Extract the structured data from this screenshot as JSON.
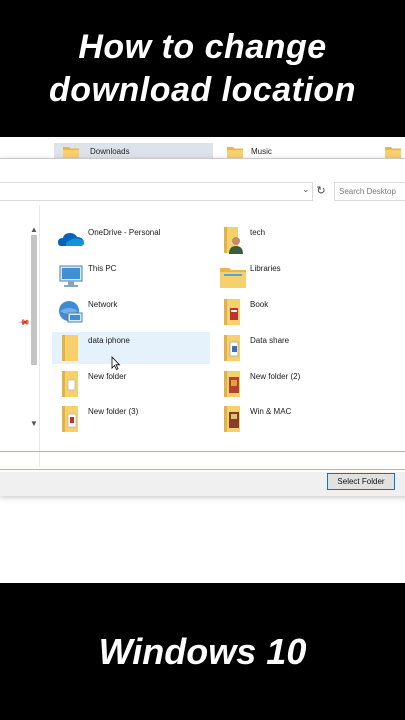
{
  "video": {
    "title": "How to change download location",
    "footer": "Windows 10"
  },
  "quick_access": {
    "downloads_label": "Downloads",
    "music_label": "Music"
  },
  "address_bar": {
    "search_placeholder": "Search Desktop"
  },
  "items": [
    {
      "label": "OneDrive - Personal",
      "icon": "onedrive-icon"
    },
    {
      "label": "tech",
      "icon": "user-folder-icon"
    },
    {
      "label": "This PC",
      "icon": "this-pc-icon"
    },
    {
      "label": "Libraries",
      "icon": "libraries-icon"
    },
    {
      "label": "Network",
      "icon": "network-icon"
    },
    {
      "label": "Book",
      "icon": "folder-icon"
    },
    {
      "label": "data iphone",
      "icon": "folder-icon"
    },
    {
      "label": "Data share",
      "icon": "folder-icon"
    },
    {
      "label": "New folder",
      "icon": "folder-icon"
    },
    {
      "label": "New folder (2)",
      "icon": "folder-icon"
    },
    {
      "label": "New folder (3)",
      "icon": "folder-icon"
    },
    {
      "label": "Win & MAC",
      "icon": "folder-icon"
    }
  ],
  "buttons": {
    "select_folder": "Select Folder"
  },
  "colors": {
    "folder": "#f6d06a",
    "selection": "#e5f1fb",
    "accent": "#0078d7"
  }
}
